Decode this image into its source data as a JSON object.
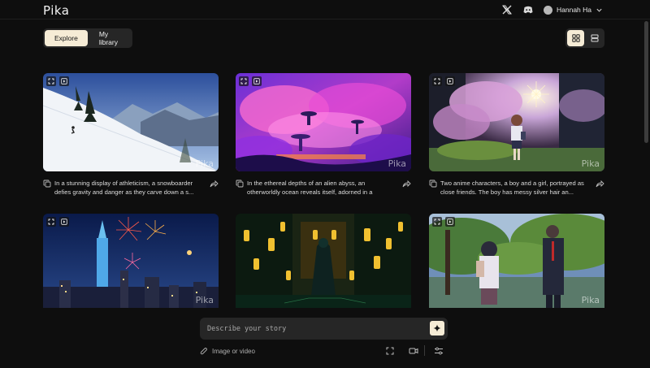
{
  "app": {
    "logo": "Pika"
  },
  "header": {
    "x_icon": "x-logo-icon",
    "discord_icon": "discord-icon",
    "user_name": "Hannah Ha"
  },
  "tabs": [
    {
      "label": "Explore",
      "active": true
    },
    {
      "label": "My library",
      "active": false
    }
  ],
  "view_toggle": {
    "grid_icon": "grid-view-icon",
    "list_icon": "list-view-icon",
    "active": "grid"
  },
  "cards": [
    {
      "caption": "In a stunning display of athleticism, a snowboarder defies gravity and danger as they carve down a s...",
      "watermark": "Pika"
    },
    {
      "caption": "In the ethereal depths of an alien abyss, an otherworldly ocean reveals itself, adorned in a duotone...",
      "watermark": "Pika"
    },
    {
      "caption": "Two anime characters, a boy and a girl, portrayed as close friends. The boy has messy silver hair an...",
      "watermark": "Pika"
    },
    {
      "caption": "",
      "watermark": "Pika"
    },
    {
      "caption": "",
      "watermark": ""
    },
    {
      "caption": "",
      "watermark": "Pika"
    }
  ],
  "prompt": {
    "placeholder": "Describe your story",
    "attach_label": "Image or video"
  },
  "colors": {
    "accent": "#f6ecd6",
    "background": "#0e0e0e",
    "panel": "#262626"
  }
}
